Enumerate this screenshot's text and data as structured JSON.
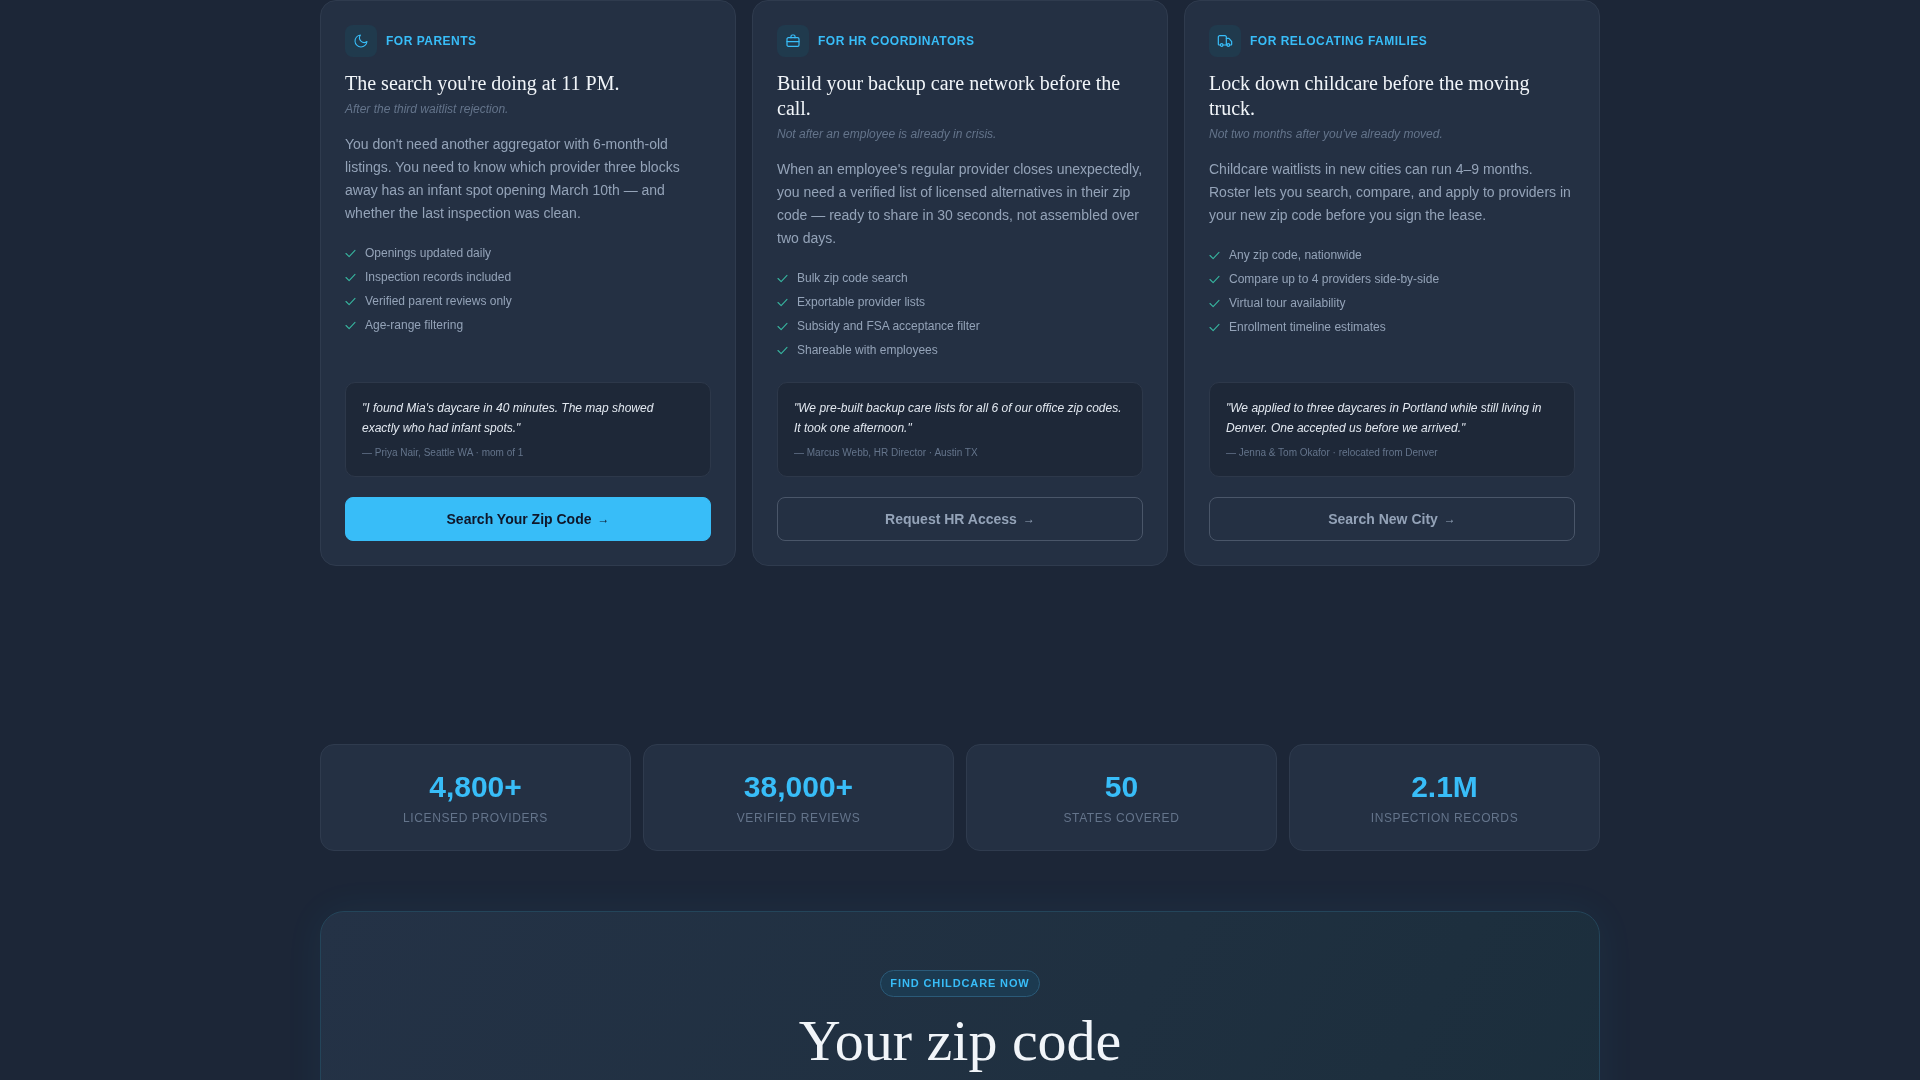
{
  "audience_cards": [
    {
      "label": "FOR PARENTS",
      "title": "The search you're doing at 11 PM.",
      "subtitle": "After the third waitlist rejection.",
      "body": "You don't need another aggregator with 6-month-old listings. You need to know which provider three blocks away has an infant spot opening March 10th — and whether the last inspection was clean.",
      "features": [
        "Openings updated daily",
        "Inspection records included",
        "Verified parent reviews only",
        "Age-range filtering"
      ],
      "quote": {
        "text": "\"I found Mia's daycare in 40 minutes. The map showed exactly who had infant spots.\"",
        "attribution": "— Priya Nair, Seattle WA · mom of 1"
      },
      "button": {
        "label": "Search Your Zip Code",
        "arrow": "→",
        "kind": "primary"
      }
    },
    {
      "label": "FOR HR COORDINATORS",
      "title": "Build your backup care network before the call.",
      "subtitle": "Not after an employee is already in crisis.",
      "body": "When an employee's regular provider closes unexpectedly, you need a verified list of licensed alternatives in their zip code — ready to share in 30 seconds, not assembled over two days.",
      "features": [
        "Bulk zip code search",
        "Exportable provider lists",
        "Subsidy and FSA acceptance filter",
        "Shareable with employees"
      ],
      "quote": {
        "text": "\"We pre-built backup care lists for all 6 of our office zip codes. It took one afternoon.\"",
        "attribution": "— Marcus Webb, HR Director · Austin TX"
      },
      "button": {
        "label": "Request HR Access",
        "arrow": "→",
        "kind": "outline"
      }
    },
    {
      "label": "FOR RELOCATING FAMILIES",
      "title": "Lock down childcare before the moving truck.",
      "subtitle": "Not two months after you've already moved.",
      "body": "Childcare waitlists in new cities can run 4–9 months. Roster lets you search, compare, and apply to providers in your new zip code before you sign the lease.",
      "features": [
        "Any zip code, nationwide",
        "Compare up to 4 providers side-by-side",
        "Virtual tour availability",
        "Enrollment timeline estimates"
      ],
      "quote": {
        "text": "\"We applied to three daycares in Portland while still living in Denver. One accepted us before we arrived.\"",
        "attribution": "— Jenna & Tom Okafor · relocated from Denver"
      },
      "button": {
        "label": "Search New City",
        "arrow": "→",
        "kind": "outline"
      }
    }
  ],
  "stats": [
    {
      "value": "4,800+",
      "label": "LICENSED PROVIDERS"
    },
    {
      "value": "38,000+",
      "label": "VERIFIED REVIEWS"
    },
    {
      "value": "50",
      "label": "STATES COVERED"
    },
    {
      "value": "2.1M",
      "label": "INSPECTION RECORDS"
    }
  ],
  "cta": {
    "badge": "FIND CHILDCARE NOW",
    "heading": "Your zip code"
  }
}
